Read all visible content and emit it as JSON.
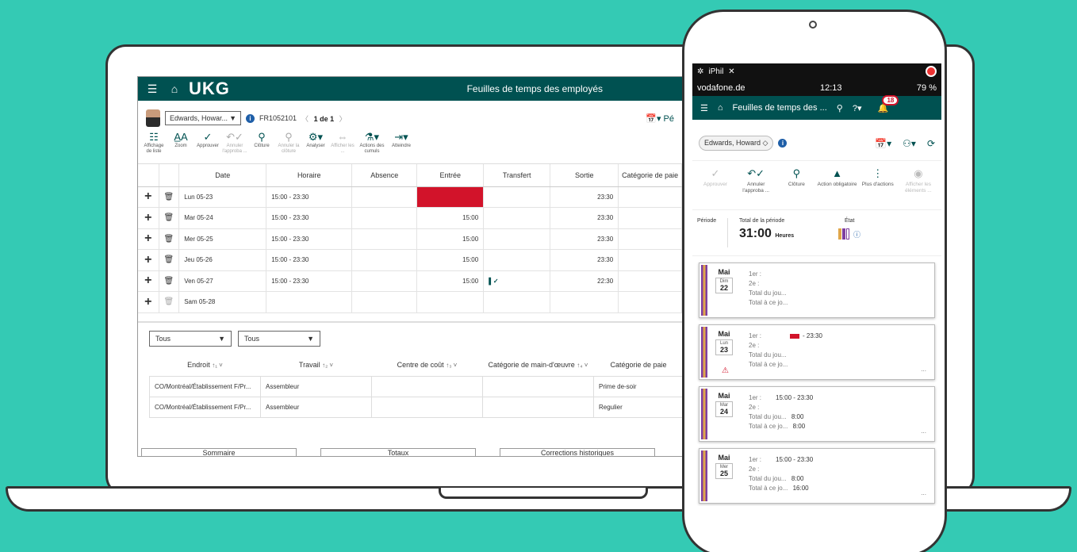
{
  "desktop": {
    "header": {
      "logo": "UKG",
      "title": "Feuilles de temps des employés"
    },
    "employee": {
      "name": "Edwards, Howar...",
      "id": "FR1052101",
      "pager": "1 de 1",
      "period_control": "Pé"
    },
    "toolbar": [
      {
        "icon": "list-icon",
        "label": "Affichage de liste",
        "enabled": true
      },
      {
        "icon": "text-size-icon",
        "label": "Zoom",
        "enabled": true
      },
      {
        "icon": "check-icon",
        "label": "Approuver",
        "enabled": true
      },
      {
        "icon": "undo-approve-icon",
        "label": "Annuler l'approba ...",
        "enabled": false
      },
      {
        "icon": "stamp-icon",
        "label": "Clôture",
        "enabled": true
      },
      {
        "icon": "stamp-cancel-icon",
        "label": "Annuler la clôture",
        "enabled": false
      },
      {
        "icon": "gear-icon",
        "label": "Analyser",
        "enabled": true
      },
      {
        "icon": "arrows-icon",
        "label": "Afficher les ...",
        "enabled": false
      },
      {
        "icon": "cumul-icon",
        "label": "Actions des cumuls",
        "enabled": true
      },
      {
        "icon": "goto-icon",
        "label": "Atteindre",
        "enabled": true
      }
    ],
    "grid": {
      "columns": [
        "Date",
        "Horaire",
        "Absence",
        "Entrée",
        "Transfert",
        "Sortie",
        "Catégorie de paie"
      ],
      "rows": [
        {
          "date": "Lun 05-23",
          "horaire": "15:00 - 23:30",
          "entree": "",
          "entree_missing": true,
          "sortie": "23:30",
          "check": false
        },
        {
          "date": "Mar 05-24",
          "horaire": "15:00 - 23:30",
          "entree": "15:00",
          "entree_missing": false,
          "sortie": "23:30",
          "check": false
        },
        {
          "date": "Mer 05-25",
          "horaire": "15:00 - 23:30",
          "entree": "15:00",
          "entree_missing": false,
          "sortie": "23:30",
          "check": false
        },
        {
          "date": "Jeu 05-26",
          "horaire": "15:00 - 23:30",
          "entree": "15:00",
          "entree_missing": false,
          "sortie": "23:30",
          "check": false
        },
        {
          "date": "Ven 05-27",
          "horaire": "15:00 - 23:30",
          "entree": "15:00",
          "entree_missing": false,
          "sortie": "22:30",
          "check": true
        },
        {
          "date": "Sam 05-28",
          "horaire": "",
          "entree": "",
          "entree_missing": false,
          "sortie": "",
          "check": false
        }
      ]
    },
    "filters": [
      "Tous",
      "Tous"
    ],
    "assign": {
      "columns": [
        "Endroit",
        "Travail",
        "Centre de coût",
        "Catégorie de main-d'œuvre",
        "Catégorie de paie"
      ],
      "rows": [
        {
          "endroit": "CO/Montréal/Établissement F/Pr...",
          "travail": "Assembleur",
          "centre": "",
          "categorie_mo": "",
          "paie": "Prime de-soir"
        },
        {
          "endroit": "CO/Montréal/Établissement F/Pr...",
          "travail": "Assembleur",
          "centre": "",
          "categorie_mo": "",
          "paie": "Regulier"
        }
      ]
    },
    "bottom_tabs": [
      "Sommaire",
      "Totaux",
      "Corrections historiques"
    ]
  },
  "mobile": {
    "ios": {
      "app": "iPhil",
      "carrier": "vodafone.de",
      "time": "12:13",
      "battery": "79 %"
    },
    "header": {
      "title": "Feuilles de temps des ...",
      "notifications": "18"
    },
    "employee": "Edwards, Howard",
    "actions": [
      {
        "icon": "check-icon",
        "label": "Approuver",
        "enabled": false
      },
      {
        "icon": "undo-approve-icon",
        "label": "Annuler l'approba ...",
        "enabled": true
      },
      {
        "icon": "stamp-icon",
        "label": "Clôture",
        "enabled": true
      },
      {
        "icon": "warning-icon",
        "label": "Action obligatoire",
        "enabled": true
      },
      {
        "icon": "more-icon",
        "label": "Plus d'actions",
        "enabled": true
      },
      {
        "icon": "view-icon",
        "label": "Afficher les éléments ...",
        "enabled": false
      }
    ],
    "period": {
      "label": "Période",
      "total_label": "Total de la période",
      "total_value": "31:00",
      "total_unit": "Heures",
      "status_label": "État",
      "status_colors": [
        "#e0a64a",
        "#7f3fa0",
        "#ffffff"
      ]
    },
    "days": [
      {
        "month": "Mai",
        "dow": "Dim",
        "day": "22",
        "first": "1er :",
        "first_val": "",
        "second": "2e :",
        "total_day": "Total du jou...",
        "total_day_val": "",
        "total_to": "Total à ce jo...",
        "total_to_val": "",
        "warning": false,
        "missing": false,
        "more": ""
      },
      {
        "month": "Mai",
        "dow": "Lun",
        "day": "23",
        "first": "1er :",
        "first_val": "- 23:30",
        "second": "2e :",
        "total_day": "Total du jou...",
        "total_day_val": "",
        "total_to": "Total à ce jo...",
        "total_to_val": "",
        "warning": true,
        "missing": true,
        "more": "..."
      },
      {
        "month": "Mai",
        "dow": "Mar",
        "day": "24",
        "first": "1er :",
        "first_val": "15:00 - 23:30",
        "second": "2e :",
        "total_day": "Total du jou...",
        "total_day_val": "8:00",
        "total_to": "Total à ce jo...",
        "total_to_val": "8:00",
        "warning": false,
        "missing": false,
        "more": "..."
      },
      {
        "month": "Mai",
        "dow": "Mer",
        "day": "25",
        "first": "1er :",
        "first_val": "15:00 - 23:30",
        "second": "2e :",
        "total_day": "Total du jou...",
        "total_day_val": "8:00",
        "total_to": "Total à ce jo...",
        "total_to_val": "16:00",
        "warning": false,
        "missing": false,
        "more": "..."
      }
    ]
  },
  "colors": {
    "brand": "#005151",
    "background": "#34cab4",
    "alert": "#d2132a"
  }
}
